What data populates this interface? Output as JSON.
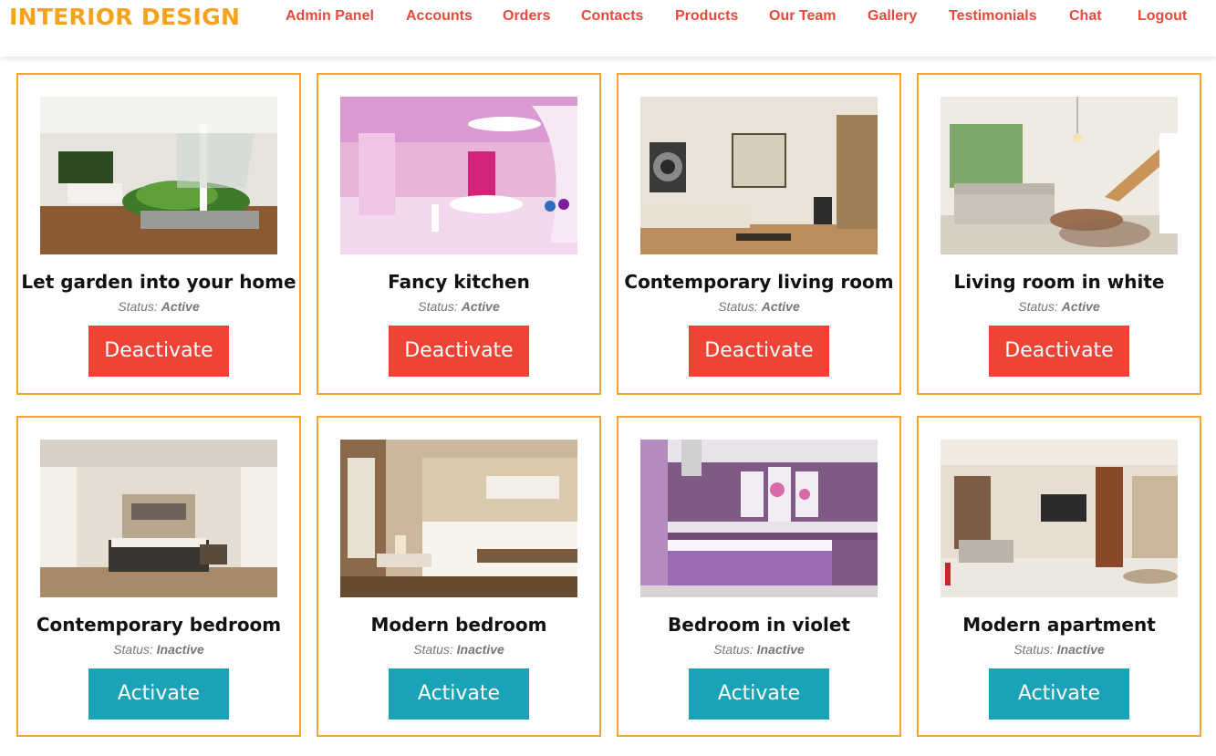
{
  "brand": {
    "name": "INTERIOR DESIGN",
    "color": "#f6a21e"
  },
  "nav": {
    "items": [
      "Admin Panel",
      "Accounts",
      "Orders",
      "Contacts",
      "Products",
      "Our Team",
      "Gallery",
      "Testimonials",
      "Chat",
      "Logout"
    ],
    "color": "#e8493b"
  },
  "colors": {
    "card_border": "#f4a52a",
    "deactivate": "#f04335",
    "activate": "#1aa2b6"
  },
  "status_label": "Status:",
  "projects": [
    {
      "title": "Let garden into your home",
      "status": "Active",
      "button": "Deactivate"
    },
    {
      "title": "Fancy kitchen",
      "status": "Active",
      "button": "Deactivate"
    },
    {
      "title": "Contemporary living room",
      "status": "Active",
      "button": "Deactivate"
    },
    {
      "title": "Living room in white",
      "status": "Active",
      "button": "Deactivate"
    },
    {
      "title": "Contemporary bedroom",
      "status": "Inactive",
      "button": "Activate"
    },
    {
      "title": "Modern bedroom",
      "status": "Inactive",
      "button": "Activate"
    },
    {
      "title": "Bedroom in violet",
      "status": "Inactive",
      "button": "Activate"
    },
    {
      "title": "Modern apartment",
      "status": "Inactive",
      "button": "Activate"
    }
  ]
}
